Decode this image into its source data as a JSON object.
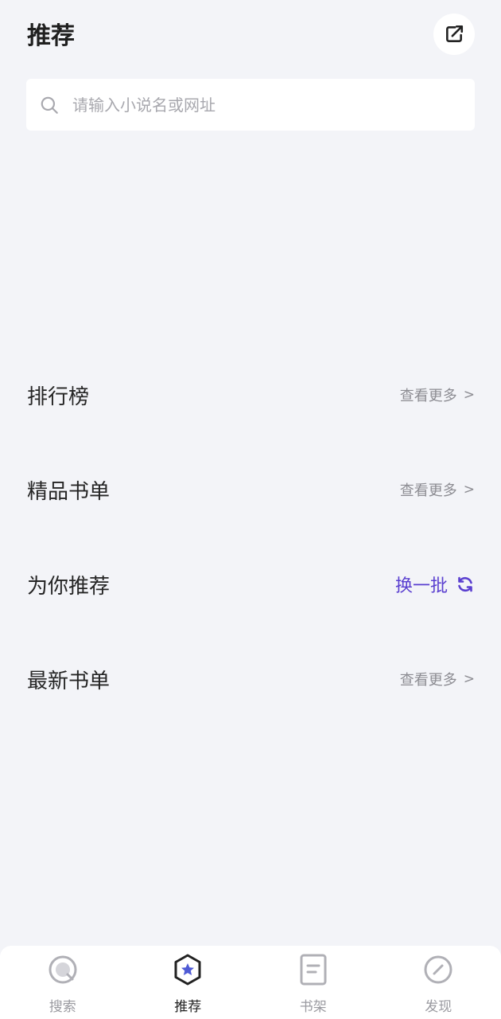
{
  "header": {
    "title": "推荐"
  },
  "search": {
    "placeholder": "请输入小说名或网址"
  },
  "sections": [
    {
      "title": "排行榜",
      "action": "查看更多",
      "action_type": "more"
    },
    {
      "title": "精品书单",
      "action": "查看更多",
      "action_type": "more"
    },
    {
      "title": "为你推荐",
      "action": "换一批",
      "action_type": "refresh"
    },
    {
      "title": "最新书单",
      "action": "查看更多",
      "action_type": "more"
    }
  ],
  "more_arrow": ">",
  "tabs": [
    {
      "label": "搜索",
      "icon": "search-icon",
      "active": false
    },
    {
      "label": "推荐",
      "icon": "star-hexagon-icon",
      "active": true
    },
    {
      "label": "书架",
      "icon": "book-icon",
      "active": false
    },
    {
      "label": "发现",
      "icon": "compass-icon",
      "active": false
    }
  ],
  "colors": {
    "background": "#f3f4f8",
    "accent": "#5a3fd0",
    "tab_active_icon": "#4f5bd5",
    "muted": "#8c8c92"
  }
}
